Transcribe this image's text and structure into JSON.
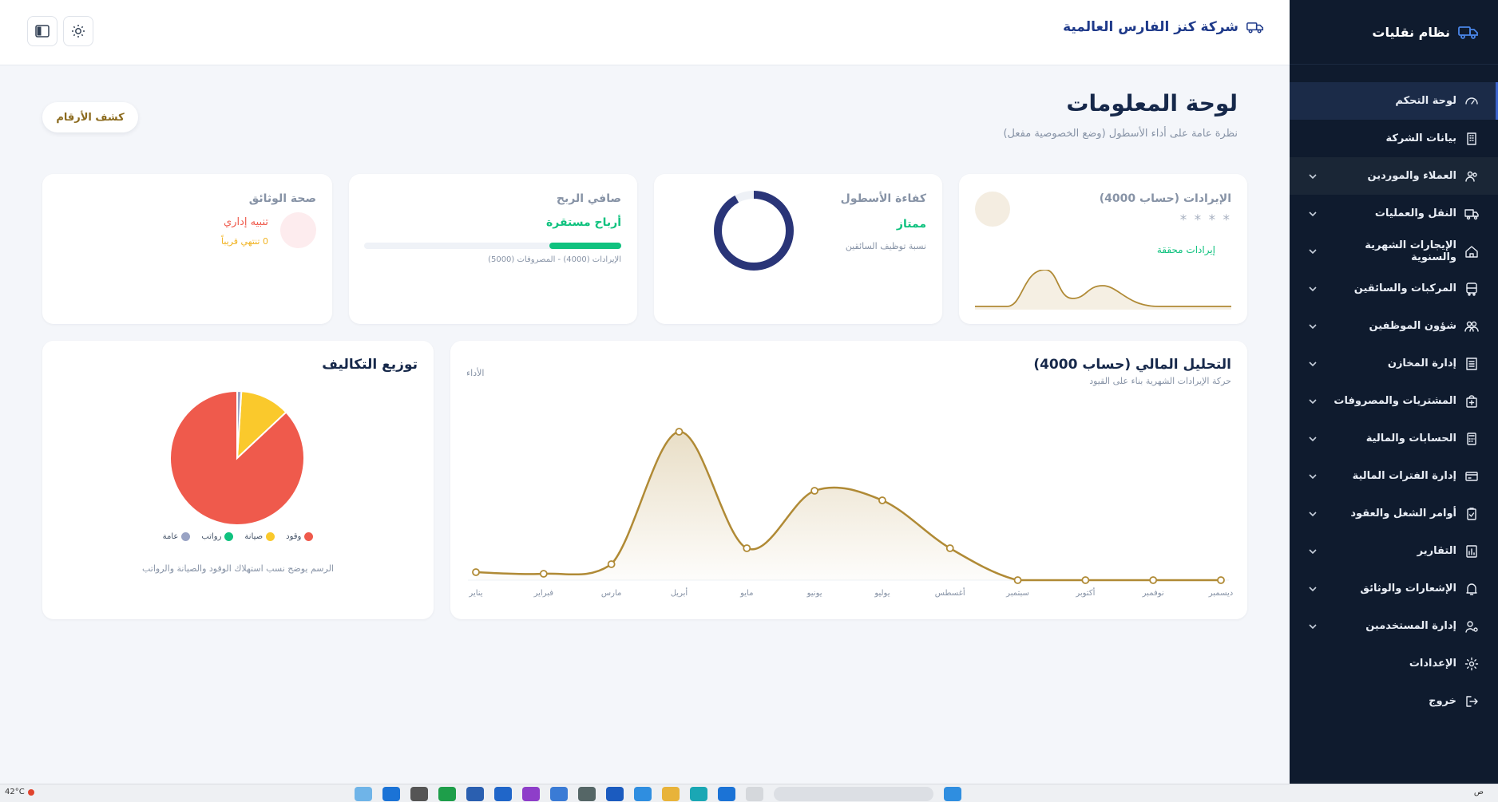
{
  "sidebar": {
    "brand": "نظام نقليات",
    "items": [
      {
        "label": "لوحة التحكم",
        "icon": "dashboard-icon",
        "chevron": false
      },
      {
        "label": "بيانات الشركة",
        "icon": "building-icon",
        "chevron": false
      },
      {
        "label": "العملاء والموردين",
        "icon": "users-icon",
        "chevron": true
      },
      {
        "label": "النقل والعمليات",
        "icon": "truck-icon",
        "chevron": true
      },
      {
        "label": "الإيجارات الشهرية والسنوية",
        "icon": "home-icon",
        "chevron": true
      },
      {
        "label": "المركبات والسائقين",
        "icon": "bus-icon",
        "chevron": true
      },
      {
        "label": "شؤون الموظفين",
        "icon": "team-icon",
        "chevron": true
      },
      {
        "label": "إدارة المخازن",
        "icon": "warehouse-icon",
        "chevron": true
      },
      {
        "label": "المشتريات والمصروفات",
        "icon": "shopping-bag-icon",
        "chevron": true
      },
      {
        "label": "الحسابات والمالية",
        "icon": "calculator-icon",
        "chevron": true
      },
      {
        "label": "إدارة الفترات المالية",
        "icon": "card-icon",
        "chevron": true
      },
      {
        "label": "أوامر الشغل والعقود",
        "icon": "clipboard-icon",
        "chevron": true
      },
      {
        "label": "التقارير",
        "icon": "report-icon",
        "chevron": true
      },
      {
        "label": "الإشعارات والوثائق",
        "icon": "bell-icon",
        "chevron": true
      },
      {
        "label": "إدارة المستخدمين",
        "icon": "user-cog-icon",
        "chevron": true
      },
      {
        "label": "الإعدادات",
        "icon": "gear-icon",
        "chevron": false
      },
      {
        "label": "خروج",
        "icon": "logout-icon",
        "chevron": false
      }
    ]
  },
  "topbar": {
    "company": "شركة كنز الفارس العالمية"
  },
  "main": {
    "title": "لوحة المعلومات",
    "subtitle": "نظرة عامة على أداء الأسطول (وضع الخصوصية مفعل)",
    "reveal_button": "كشف الأرقام"
  },
  "kpis": {
    "revenue": {
      "title": "الإيرادات (حساب 4000)",
      "masked": "* * * *",
      "status": "إيرادات محققة"
    },
    "fleet": {
      "title": "كفاءة الأسطول",
      "status": "ممتاز",
      "note": "نسبة توظيف السائقين",
      "value_pct": 92
    },
    "profit": {
      "title": "صافي الربح",
      "status": "أرباح مستقرة",
      "note": "الإيرادات (4000) - المصروفات (5000)",
      "progress_pct": 28
    },
    "docs": {
      "title": "صحة الوثائق",
      "status": "تنبيه إداري",
      "note": "0 تنتهي قريباً"
    }
  },
  "colors": {
    "gold": "#b08a35",
    "navy": "#2a3578",
    "green": "#10c27f",
    "red": "#ef5a4c",
    "yellow": "#fac92c",
    "slate": "#99a3c4"
  },
  "chart_data": [
    {
      "type": "area",
      "title": "التحليل المالي (حساب 4000)",
      "subtitle": "حركة الإيرادات الشهرية بناء على القيود",
      "legend": "الأداء",
      "categories": [
        "يناير",
        "فبراير",
        "مارس",
        "أبريل",
        "مايو",
        "يونيو",
        "يوليو",
        "أغسطس",
        "سبتمبر",
        "أكتوبر",
        "نوفمبر",
        "ديسمبر"
      ],
      "values": [
        5,
        4,
        10,
        93,
        20,
        56,
        50,
        20,
        0,
        0,
        0,
        0
      ],
      "ylim": [
        0,
        100
      ],
      "grid": false
    },
    {
      "type": "pie",
      "title": "توزيع التكاليف",
      "note": "الرسم يوضح نسب استهلاك الوقود والصيانة والرواتب",
      "slices": [
        {
          "name": "وقود",
          "value": 87
        },
        {
          "name": "صيانة",
          "value": 12
        },
        {
          "name": "رواتب",
          "value": 0
        },
        {
          "name": "عامة",
          "value": 1
        }
      ]
    }
  ],
  "taskbar": {
    "weather": "42°C",
    "clock_text": "ص"
  }
}
